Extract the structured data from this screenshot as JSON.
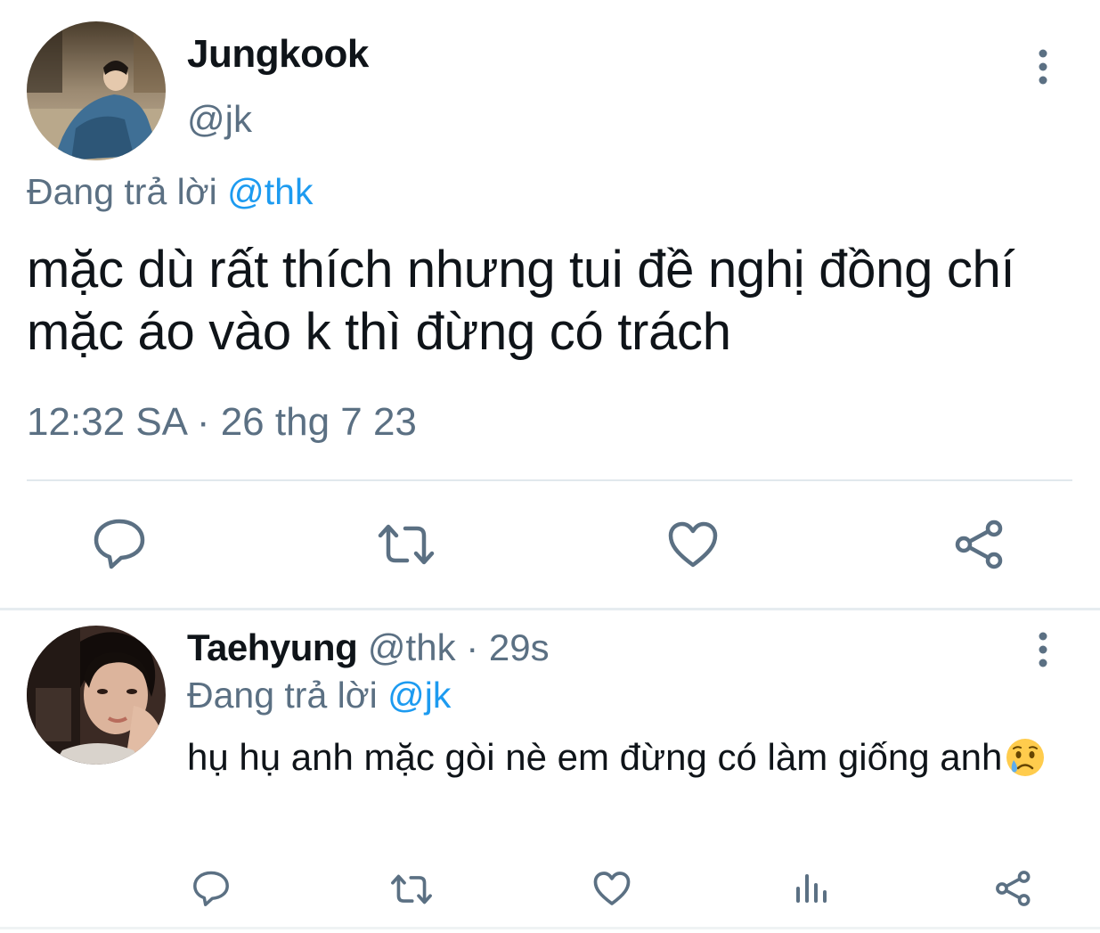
{
  "main_tweet": {
    "author_name": "Jungkook",
    "handle": "@jk",
    "replying_prefix": "Đang trả lời",
    "replying_to": "@thk",
    "text": "mặc dù rất thích nhưng tui đề nghị đồng chí mặc áo vào k thì đừng có trách",
    "timestamp": "12:32 SA · 26 thg 7 23",
    "actions": [
      {
        "icon": "reply-icon"
      },
      {
        "icon": "retweet-icon"
      },
      {
        "icon": "like-icon"
      },
      {
        "icon": "share-icon"
      }
    ]
  },
  "reply_tweet": {
    "author_name": "Taehyung",
    "handle": "@thk",
    "separator": "·",
    "time_ago": "29s",
    "replying_prefix": "Đang trả lời",
    "replying_to": "@jk",
    "text": "hụ hụ anh mặc gòi nè em đừng có làm giống anh",
    "emoji": "crying-face-emoji",
    "actions": [
      {
        "icon": "reply-icon"
      },
      {
        "icon": "retweet-icon"
      },
      {
        "icon": "like-icon"
      },
      {
        "icon": "analytics-icon"
      },
      {
        "icon": "share-icon"
      }
    ]
  },
  "colors": {
    "text": "#0f1419",
    "muted": "#5b7083",
    "link": "#1d9bf0",
    "divider": "#e1e8ed"
  }
}
